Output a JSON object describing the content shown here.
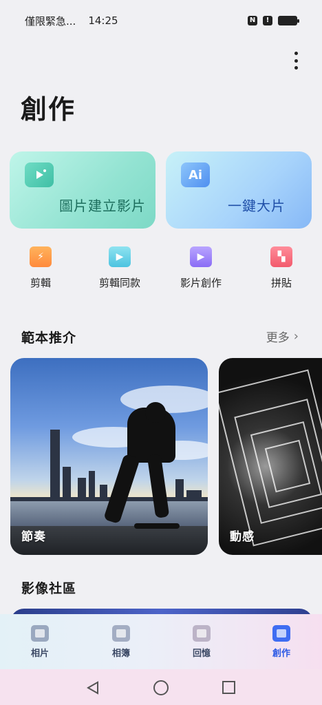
{
  "status_bar": {
    "carrier": "僅限緊急...",
    "time": "14:25",
    "icons": [
      "nfc-icon",
      "alert-icon",
      "battery-charging-icon"
    ]
  },
  "header": {
    "title": "創作",
    "menu_icon": "more-vertical-icon"
  },
  "quick_actions": [
    {
      "label": "圖片建立影片",
      "icon": "photo-to-video-icon",
      "color": "#7dd9c6"
    },
    {
      "label": "一鍵大片",
      "icon": "ai-icon",
      "color": "#86b8f6"
    }
  ],
  "tools": [
    {
      "label": "剪輯",
      "icon": "clapperboard-icon",
      "color": "#ff8a3c"
    },
    {
      "label": "剪輯同款",
      "icon": "video-template-icon",
      "color": "#4cc3e0"
    },
    {
      "label": "影片創作",
      "icon": "video-camera-icon",
      "color": "#8a6cf5"
    },
    {
      "label": "拼貼",
      "icon": "collage-icon",
      "color": "#f25a6c"
    }
  ],
  "templates": {
    "title": "範本推介",
    "more_label": "更多",
    "items": [
      {
        "caption": "節奏"
      },
      {
        "caption": "動感"
      }
    ]
  },
  "community": {
    "title": "影像社區"
  },
  "bottom_nav": {
    "items": [
      {
        "label": "相片",
        "icon": "photo-icon"
      },
      {
        "label": "相簿",
        "icon": "album-icon"
      },
      {
        "label": "回憶",
        "icon": "memories-icon"
      },
      {
        "label": "創作",
        "icon": "create-icon",
        "active": true
      }
    ],
    "active_color": "#2d5ae5"
  },
  "system_nav": [
    "back-icon",
    "home-icon",
    "recent-apps-icon"
  ]
}
